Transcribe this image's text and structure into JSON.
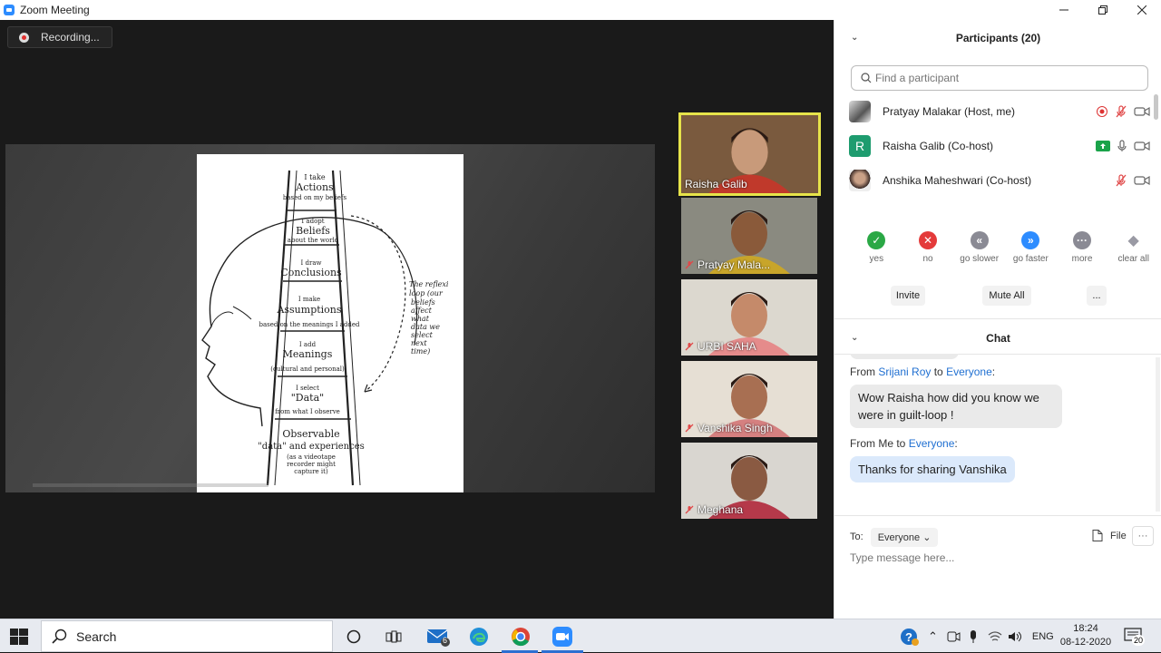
{
  "window": {
    "title": "Zoom Meeting",
    "controls": [
      "minimize",
      "restore",
      "close"
    ]
  },
  "recording": {
    "label": "Recording..."
  },
  "shared_slide": {
    "ladder_rungs": [
      "I take Actions based on my beliefs",
      "I adopt Beliefs about the world",
      "I draw Conclusions",
      "I make Assumptions based on the meanings I added",
      "I add Meanings (cultural and personal)",
      "I select \"Data\" from what I observe",
      "Observable \"data\" and experiences (as a videotape recorder might capture it)"
    ],
    "reflexive_note": "The reflexive loop (our beliefs affect what data we select next time)"
  },
  "thumbnails": [
    {
      "name": "Raisha Galib",
      "active": true,
      "muted": false,
      "bg": "#7a5a3e",
      "face": "#c89a7a",
      "shirt": "#c0392b"
    },
    {
      "name": "Pratyay Mala...",
      "active": false,
      "muted": true,
      "bg": "#8a8a80",
      "face": "#8a5a3a",
      "shirt": "#c8a52a"
    },
    {
      "name": "URBI SAHA",
      "active": false,
      "muted": true,
      "bg": "#dcd8cf",
      "face": "#c58a6a",
      "shirt": "#e58b8b"
    },
    {
      "name": "Vanshika Singh",
      "active": false,
      "muted": true,
      "bg": "#e6dfd4",
      "face": "#a86f52",
      "shirt": "#d58080"
    },
    {
      "name": "Meghana",
      "active": false,
      "muted": true,
      "bg": "#d9d6d0",
      "face": "#8a5a42",
      "shirt": "#b5394a"
    }
  ],
  "participants": {
    "title": "Participants (20)",
    "search_placeholder": "Find a participant",
    "list": [
      {
        "name": "Pratyay Malakar (Host, me)",
        "avatar": "photo",
        "icons": [
          "recording-icon",
          "mic-muted-icon",
          "video-off-icon"
        ]
      },
      {
        "name": "Raisha Galib (Co-host)",
        "avatar": "R",
        "icons": [
          "share-screen-icon",
          "mic-icon",
          "video-off-icon"
        ]
      },
      {
        "name": "Anshika Maheshwari (Co-host)",
        "avatar": "photo",
        "icons": [
          "mic-muted-icon",
          "video-off-icon"
        ]
      }
    ],
    "reactions": [
      {
        "label": "yes",
        "symbol": "✓",
        "color": "#2aa845"
      },
      {
        "label": "no",
        "symbol": "✕",
        "color": "#e43a3a"
      },
      {
        "label": "go slower",
        "symbol": "«",
        "color": "#8a8a94"
      },
      {
        "label": "go faster",
        "symbol": "»",
        "color": "#2d8cff"
      },
      {
        "label": "more",
        "symbol": "···",
        "color": "#8a8a94"
      },
      {
        "label": "clear all",
        "symbol": "◆",
        "color": "#9a9aa4"
      }
    ],
    "buttons": {
      "invite": "Invite",
      "mute_all": "Mute All",
      "more": "..."
    }
  },
  "chat": {
    "title": "Chat",
    "messages": [
      {
        "from_prefix": "From",
        "sender": "Srijani Roy",
        "to_word": "to",
        "recipient": "Everyone",
        "text": "Wow Raisha how did you know we were in guilt-loop !",
        "mine": false
      },
      {
        "from_prefix": "From Me",
        "sender": "",
        "to_word": "to",
        "recipient": "Everyone",
        "text": "Thanks for sharing Vanshika",
        "mine": true
      }
    ],
    "to_label": "To:",
    "to_value": "Everyone",
    "file_label": "File",
    "input_placeholder": "Type message here..."
  },
  "taskbar": {
    "search_label": "Search",
    "mail_badge": "6",
    "language": "ENG",
    "time": "18:24",
    "date": "08-12-2020",
    "notification_count": "20"
  }
}
